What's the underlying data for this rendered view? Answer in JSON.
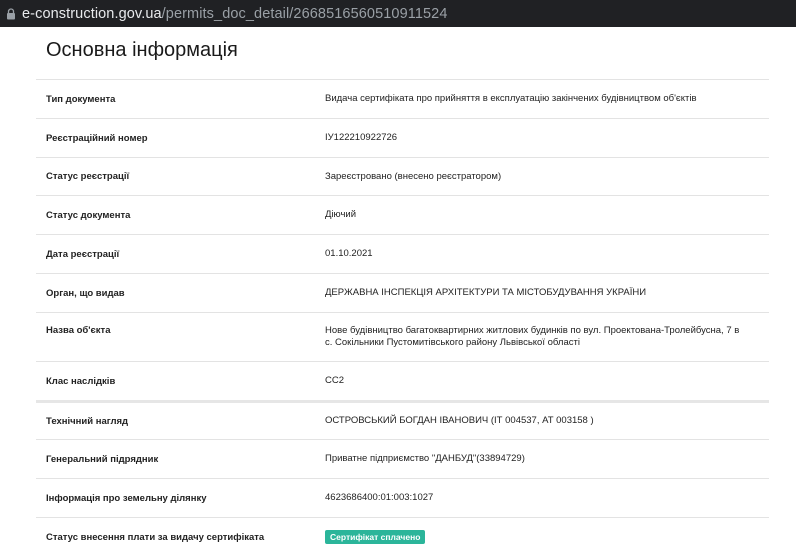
{
  "browser": {
    "url_host": "e-construction.gov.ua",
    "url_path": "/permits_doc_detail/2668516560510911524"
  },
  "section_title": "Основна інформація",
  "rows": [
    {
      "label": "Тип документа",
      "value": "Видача сертифіката про прийняття в експлуатацію закінчених будівництвом об'єктів"
    },
    {
      "label": "Реєстраційний номер",
      "value": "ІУ122210922726"
    },
    {
      "label": "Статус реєстрації",
      "value": "Зареєстровано (внесено реєстратором)"
    },
    {
      "label": "Статус документа",
      "value": "Діючий"
    },
    {
      "label": "Дата реєстрації",
      "value": "01.10.2021"
    },
    {
      "label": "Орган, що видав",
      "value": "ДЕРЖАВНА ІНСПЕКЦІЯ АРХІТЕКТУРИ ТА МІСТОБУДУВАННЯ УКРАЇНИ"
    },
    {
      "label": "Назва об'єкта",
      "value": "Нове будівництво багатоквартирних житлових будинків по вул. Проектована-Тролейбусна, 7 в с. Сокільники Пустомитівського району Львівської області"
    },
    {
      "label": "Клас наслідків",
      "value": "СС2"
    },
    {
      "label": "Технічний нагляд",
      "value": "ОСТРОВСЬКИЙ БОГДАН ІВАНОВИЧ (ІТ 004537, АТ 003158 )"
    },
    {
      "label": "Генеральний підрядник",
      "value": "Приватне підприємство \"ДАНБУД\"(33894729)"
    },
    {
      "label": "Інформація про земельну ділянку",
      "value": "4623686400:01:003:1027"
    },
    {
      "label": "Статус внесення плати за видачу сертифіката",
      "badge": "Сертифікат сплачено"
    }
  ],
  "colors": {
    "badge_bg": "#2bb59a",
    "browser_bar": "#202124"
  }
}
